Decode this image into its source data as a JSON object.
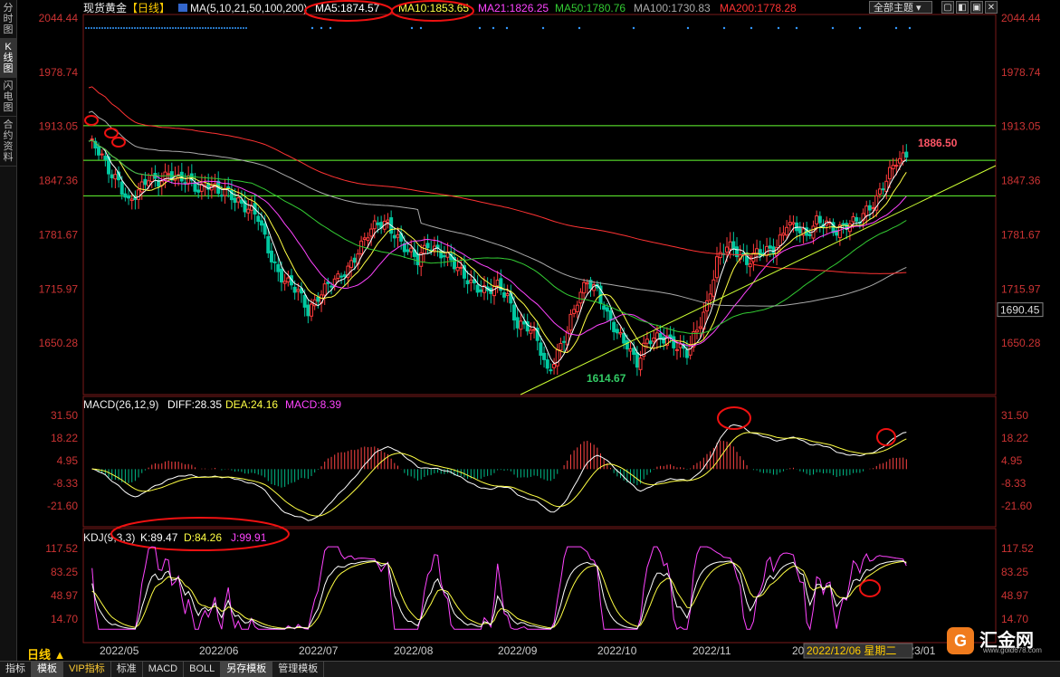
{
  "sidebar": {
    "items": [
      {
        "label": "分时图",
        "active": false
      },
      {
        "label": "K线图",
        "active": true
      },
      {
        "label": "闪电图",
        "active": false
      },
      {
        "label": "合约资料",
        "active": false
      }
    ]
  },
  "header": {
    "symbol": "现货黄金",
    "period": "【日线】",
    "ma_params": "MA(5,10,21,50,100,200)",
    "ma5": "MA5:1874.57",
    "ma10": "MA10:1853.65",
    "ma21": "MA21:1826.25",
    "ma50": "MA50:1780.76",
    "ma100": "MA100:1730.83",
    "ma200": "MA200:1778.28",
    "theme": "全部主题"
  },
  "macd_header": {
    "name": "MACD(26,12,9)",
    "diff": "DIFF:28.35",
    "dea": "DEA:24.16",
    "macd": "MACD:8.39"
  },
  "kdj_header": {
    "name": "KDJ(9,3,3)",
    "k": "K:89.47",
    "d": "D:84.26",
    "j": "J:99.91"
  },
  "price_annotations": {
    "high": "1886.50",
    "low": "1614.67",
    "current": "1690.45"
  },
  "colors": {
    "up": "#ff3b3b",
    "down": "#00c8a0",
    "ma5": "#ffffff",
    "ma10": "#ffff44",
    "ma21": "#ff44ff",
    "ma50": "#33cc33",
    "ma100": "#aaaaaa",
    "ma200": "#ff3333"
  },
  "chart_data": {
    "type": "candlestick",
    "price_axis": {
      "ticks": [
        "2044.44",
        "1978.74",
        "1913.05",
        "1847.36",
        "1781.67",
        "1715.97",
        "1650.28"
      ],
      "ylim": [
        1588,
        2044.44
      ]
    },
    "macd_axis": {
      "ticks": [
        "31.50",
        "18.22",
        "4.95",
        "-8.33",
        "-21.60"
      ]
    },
    "kdj_axis": {
      "ticks": [
        "117.52",
        "83.25",
        "48.97",
        "14.70"
      ]
    },
    "x_ticks": [
      "2022/05",
      "2022/06",
      "2022/07",
      "2022/08",
      "2022/09",
      "2022/10",
      "2022/11",
      "2022/12",
      "2023/01"
    ],
    "cursor_label": "2022/12/06 星期二",
    "close_anchors": [
      [
        0,
        1895
      ],
      [
        3,
        1880
      ],
      [
        6,
        1860
      ],
      [
        9,
        1850
      ],
      [
        12,
        1820
      ],
      [
        15,
        1830
      ],
      [
        18,
        1852
      ],
      [
        21,
        1850
      ],
      [
        24,
        1855
      ],
      [
        27,
        1845
      ],
      [
        30,
        1850
      ],
      [
        33,
        1840
      ],
      [
        36,
        1842
      ],
      [
        39,
        1830
      ],
      [
        42,
        1835
      ],
      [
        45,
        1825
      ],
      [
        48,
        1812
      ],
      [
        51,
        1800
      ],
      [
        54,
        1765
      ],
      [
        57,
        1738
      ],
      [
        60,
        1722
      ],
      [
        63,
        1710
      ],
      [
        66,
        1690
      ],
      [
        69,
        1710
      ],
      [
        72,
        1720
      ],
      [
        75,
        1725
      ],
      [
        78,
        1742
      ],
      [
        81,
        1765
      ],
      [
        84,
        1782
      ],
      [
        87,
        1792
      ],
      [
        90,
        1797
      ],
      [
        93,
        1780
      ],
      [
        96,
        1760
      ],
      [
        99,
        1748
      ],
      [
        102,
        1772
      ],
      [
        105,
        1765
      ],
      [
        108,
        1752
      ],
      [
        111,
        1738
      ],
      [
        114,
        1730
      ],
      [
        117,
        1720
      ],
      [
        120,
        1710
      ],
      [
        123,
        1718
      ],
      [
        126,
        1710
      ],
      [
        129,
        1675
      ],
      [
        132,
        1668
      ],
      [
        135,
        1652
      ],
      [
        138,
        1618
      ],
      [
        141,
        1640
      ],
      [
        144,
        1663
      ],
      [
        147,
        1700
      ],
      [
        150,
        1730
      ],
      [
        153,
        1716
      ],
      [
        156,
        1680
      ],
      [
        159,
        1660
      ],
      [
        162,
        1652
      ],
      [
        165,
        1628
      ],
      [
        168,
        1650
      ],
      [
        171,
        1655
      ],
      [
        174,
        1660
      ],
      [
        177,
        1648
      ],
      [
        180,
        1635
      ],
      [
        183,
        1665
      ],
      [
        186,
        1700
      ],
      [
        189,
        1752
      ],
      [
        192,
        1765
      ],
      [
        195,
        1760
      ],
      [
        198,
        1752
      ],
      [
        201,
        1762
      ],
      [
        204,
        1758
      ],
      [
        207,
        1765
      ],
      [
        210,
        1800
      ],
      [
        213,
        1792
      ],
      [
        216,
        1775
      ],
      [
        219,
        1798
      ],
      [
        222,
        1800
      ],
      [
        225,
        1786
      ],
      [
        228,
        1790
      ],
      [
        231,
        1798
      ],
      [
        234,
        1815
      ],
      [
        237,
        1825
      ],
      [
        240,
        1845
      ],
      [
        243,
        1872
      ],
      [
        246,
        1882
      ]
    ],
    "lines": [
      {
        "name": "horizontal-1913",
        "value": 1914
      },
      {
        "name": "horizontal-1872",
        "value": 1872
      },
      {
        "name": "horizontal-1829",
        "value": 1829
      }
    ]
  },
  "bottom_tabs": [
    {
      "label": "指标",
      "active": false
    },
    {
      "label": "模板",
      "active": true
    },
    {
      "label": "VIP指标",
      "active": false,
      "vip": true
    },
    {
      "label": "标准",
      "active": false
    },
    {
      "label": "MACD",
      "active": false
    },
    {
      "label": "BOLL",
      "active": false
    },
    {
      "label": "另存模板",
      "active": true
    },
    {
      "label": "管理模板",
      "active": false
    }
  ],
  "footer": {
    "period": "日线 ▲",
    "brand": "汇金网",
    "url": "www.gold678.com"
  }
}
